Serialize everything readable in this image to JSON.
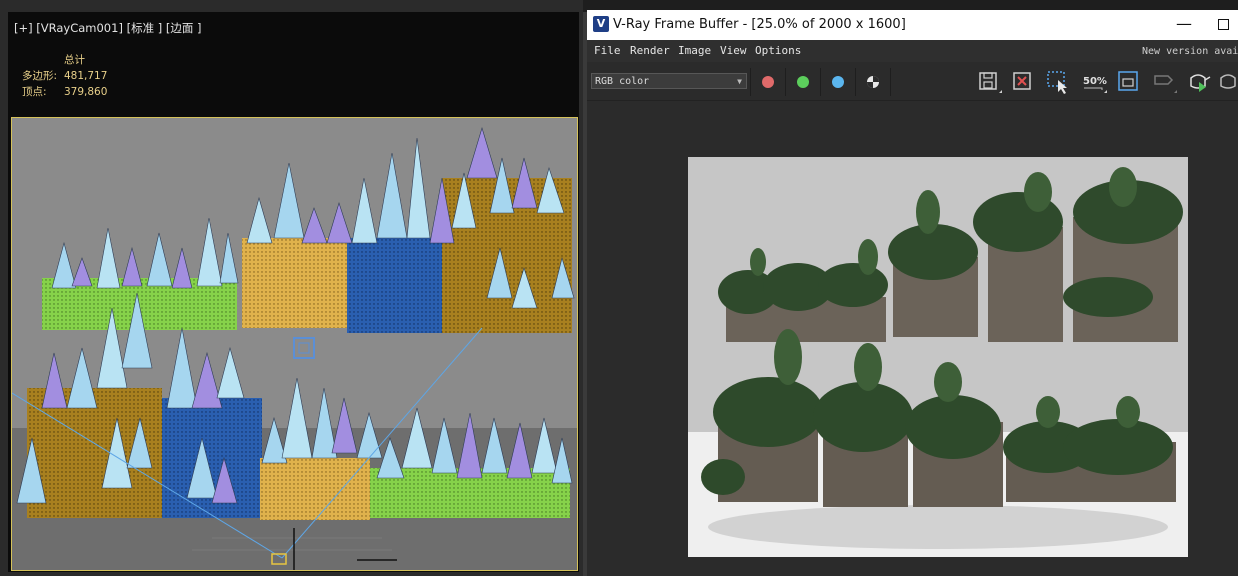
{
  "viewport": {
    "label": "[+] [VRayCam001] [标准 ] [边面 ]",
    "stats": {
      "header": "总计",
      "polygons_label": "多边形:",
      "polygons_value": "481,717",
      "vertices_label": "顶点:",
      "vertices_value": "379,860"
    }
  },
  "vfb": {
    "title": "V-Ray Frame Buffer - [25.0% of 2000 x 1600]",
    "title_icon": "V",
    "menu": [
      "File",
      "Render",
      "Image",
      "View",
      "Options"
    ],
    "new_version": "New version avai",
    "channel": "RGB color",
    "channel_buttons": [
      {
        "name": "red-channel",
        "color": "#e06060"
      },
      {
        "name": "green-channel",
        "color": "#55cc55"
      },
      {
        "name": "blue-channel",
        "color": "#5ab4f0"
      }
    ],
    "zoom_label": "50%"
  },
  "colors": {
    "vfb_accent": "#3a7bd5",
    "viewport_border": "#d5c25a",
    "stats_text": "#e8d08a"
  }
}
